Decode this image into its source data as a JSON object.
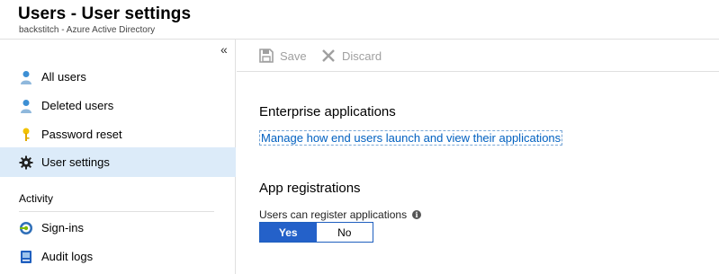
{
  "header": {
    "title": "Users - User settings",
    "subtitle": "backstitch - Azure Active Directory"
  },
  "sidebar": {
    "collapse_glyph": "«",
    "items": [
      {
        "label": "All users",
        "icon": "user-icon"
      },
      {
        "label": "Deleted users",
        "icon": "user-icon"
      },
      {
        "label": "Password reset",
        "icon": "key-icon"
      },
      {
        "label": "User settings",
        "icon": "gear-icon",
        "selected": true
      }
    ],
    "section_activity": "Activity",
    "activity_items": [
      {
        "label": "Sign-ins",
        "icon": "sign-ins-icon"
      },
      {
        "label": "Audit logs",
        "icon": "audit-logs-icon"
      }
    ]
  },
  "toolbar": {
    "save_label": "Save",
    "discard_label": "Discard"
  },
  "main": {
    "enterprise_heading": "Enterprise applications",
    "enterprise_link": "Manage how end users launch and view their applications",
    "app_reg_heading": "App registrations",
    "register_label": "Users can register applications",
    "info_glyph": "i",
    "toggle_yes": "Yes",
    "toggle_no": "No",
    "toggle_selected": "Yes"
  },
  "colors": {
    "accent": "#2461c9",
    "link": "#0060c0",
    "selected_bg": "#dcebf9",
    "disabled": "#a0a0a0"
  }
}
